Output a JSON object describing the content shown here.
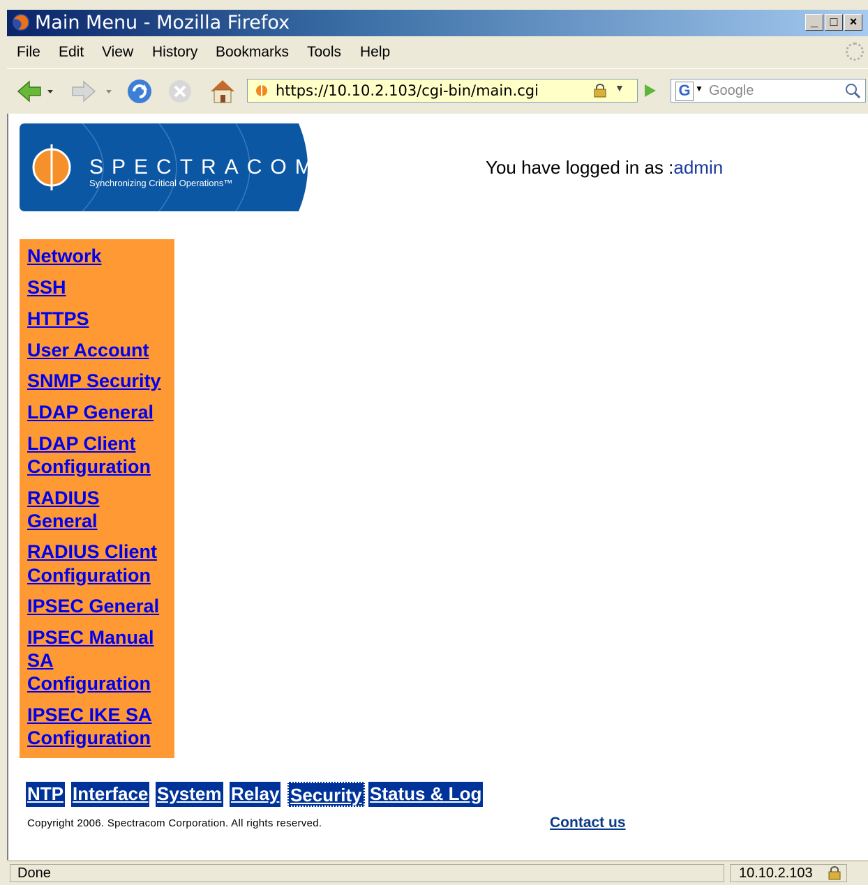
{
  "window": {
    "title": "Main Menu - Mozilla Firefox"
  },
  "menubar": {
    "items": [
      "File",
      "Edit",
      "View",
      "History",
      "Bookmarks",
      "Tools",
      "Help"
    ]
  },
  "toolbar": {
    "url": "https://10.10.2.103/cgi-bin/main.cgi",
    "search_placeholder": "Google"
  },
  "header": {
    "logo_text": "SPECTRACOM",
    "logo_tagline": "Synchronizing Critical Operations™",
    "login_prefix": "You have logged in as :",
    "login_user": "admin"
  },
  "leftnav": {
    "items": [
      "Network",
      "SSH",
      "HTTPS",
      "User Account",
      "SNMP Security",
      "LDAP General",
      "LDAP Client",
      "Configuration",
      "RADIUS",
      "General",
      "RADIUS Client",
      "Configuration",
      "IPSEC General",
      "IPSEC Manual",
      "SA",
      "Configuration",
      "IPSEC IKE SA",
      "Configuration"
    ]
  },
  "tabs": [
    "NTP",
    "Interface",
    "System",
    "Relay",
    "Security",
    "Status & Log"
  ],
  "footer": {
    "copyright": "Copyright 2006. Spectracom Corporation. All rights reserved.",
    "contact": "Contact us"
  },
  "statusbar": {
    "status": "Done",
    "host": "10.10.2.103"
  },
  "colors": {
    "nav_bg": "#ff9933",
    "tab_bg": "#003399",
    "logo_bg": "#0b57a4",
    "link": "#0000ee"
  },
  "icons": [
    "firefox-icon",
    "back-icon",
    "forward-icon",
    "reload-icon",
    "stop-icon",
    "home-icon",
    "lock-icon",
    "go-icon",
    "google-icon",
    "magnifier-icon",
    "throbber-icon"
  ]
}
